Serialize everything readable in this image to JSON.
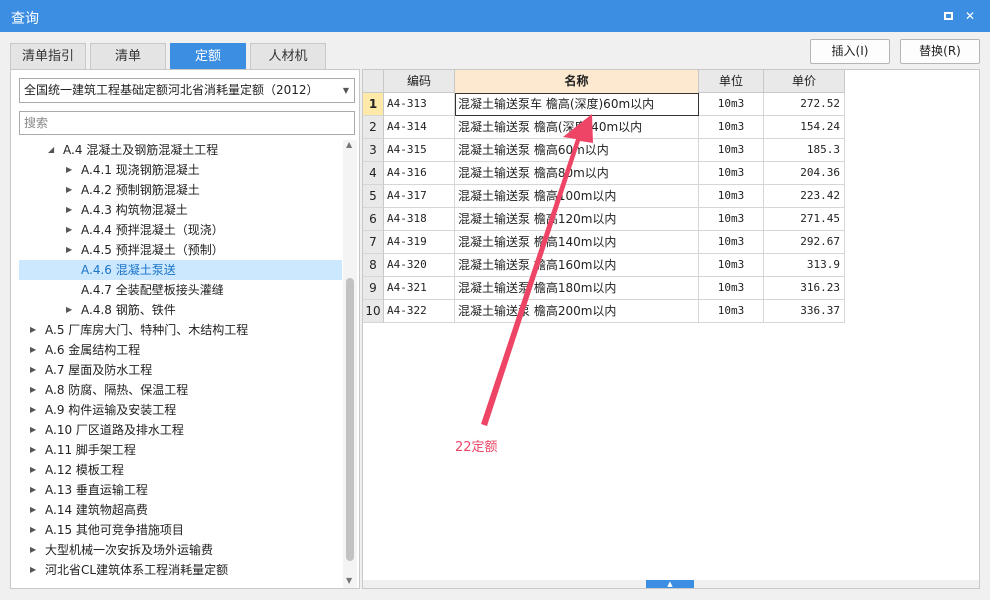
{
  "window": {
    "title": "查询"
  },
  "tabs": [
    "清单指引",
    "清单",
    "定额",
    "人材机"
  ],
  "active_tab": 2,
  "buttons": {
    "insert": "插入(I)",
    "replace": "替换(R)"
  },
  "quota_selector": {
    "value": "全国统一建筑工程基础定额河北省消耗量定额（2012）"
  },
  "search": {
    "placeholder": "搜索"
  },
  "tree": [
    {
      "label": "A.4 混凝土及钢筋混凝土工程",
      "level": 1,
      "expanded": true
    },
    {
      "label": "A.4.1 现浇钢筋混凝土",
      "level": 2
    },
    {
      "label": "A.4.2 预制钢筋混凝土",
      "level": 2
    },
    {
      "label": "A.4.3 构筑物混凝土",
      "level": 2
    },
    {
      "label": "A.4.4 预拌混凝土（现浇）",
      "level": 2
    },
    {
      "label": "A.4.5 预拌混凝土（预制）",
      "level": 2
    },
    {
      "label": "A.4.6 混凝土泵送",
      "level": 2,
      "selected": true,
      "leaf": true
    },
    {
      "label": "A.4.7 全装配壁板接头灌缝",
      "level": 2,
      "leaf": true
    },
    {
      "label": "A.4.8 钢筋、铁件",
      "level": 2
    },
    {
      "label": "A.5 厂库房大门、特种门、木结构工程",
      "level": 0
    },
    {
      "label": "A.6 金属结构工程",
      "level": 0
    },
    {
      "label": "A.7 屋面及防水工程",
      "level": 0
    },
    {
      "label": "A.8 防腐、隔热、保温工程",
      "level": 0
    },
    {
      "label": "A.9 构件运输及安装工程",
      "level": 0
    },
    {
      "label": "A.10 厂区道路及排水工程",
      "level": 0
    },
    {
      "label": "A.11 脚手架工程",
      "level": 0
    },
    {
      "label": "A.12 模板工程",
      "level": 0
    },
    {
      "label": "A.13 垂直运输工程",
      "level": 0
    },
    {
      "label": "A.14 建筑物超高费",
      "level": 0
    },
    {
      "label": "A.15 其他可竞争措施项目",
      "level": 0
    },
    {
      "label": "大型机械一次安拆及场外运输费",
      "level": 0
    },
    {
      "label": "河北省CL建筑体系工程消耗量定额",
      "level": 0
    }
  ],
  "grid": {
    "columns": [
      "编码",
      "名称",
      "单位",
      "单价"
    ],
    "rows": [
      {
        "idx": "1",
        "code": "A4-313",
        "name": "混凝土输送泵车 檐高(深度)60m以内",
        "unit": "10m3",
        "price": "272.52"
      },
      {
        "idx": "2",
        "code": "A4-314",
        "name": "混凝土输送泵 檐高(深度)40m以内",
        "unit": "10m3",
        "price": "154.24"
      },
      {
        "idx": "3",
        "code": "A4-315",
        "name": "混凝土输送泵 檐高60m以内",
        "unit": "10m3",
        "price": "185.3"
      },
      {
        "idx": "4",
        "code": "A4-316",
        "name": "混凝土输送泵 檐高80m以内",
        "unit": "10m3",
        "price": "204.36"
      },
      {
        "idx": "5",
        "code": "A4-317",
        "name": "混凝土输送泵 檐高100m以内",
        "unit": "10m3",
        "price": "223.42"
      },
      {
        "idx": "6",
        "code": "A4-318",
        "name": "混凝土输送泵 檐高120m以内",
        "unit": "10m3",
        "price": "271.45"
      },
      {
        "idx": "7",
        "code": "A4-319",
        "name": "混凝土输送泵 檐高140m以内",
        "unit": "10m3",
        "price": "292.67"
      },
      {
        "idx": "8",
        "code": "A4-320",
        "name": "混凝土输送泵 檐高160m以内",
        "unit": "10m3",
        "price": "313.9"
      },
      {
        "idx": "9",
        "code": "A4-321",
        "name": "混凝土输送泵 檐高180m以内",
        "unit": "10m3",
        "price": "316.23"
      },
      {
        "idx": "10",
        "code": "A4-322",
        "name": "混凝土输送泵 檐高200m以内",
        "unit": "10m3",
        "price": "336.37"
      }
    ]
  },
  "annotation": {
    "text": "22定额",
    "color": "#ee4466"
  }
}
